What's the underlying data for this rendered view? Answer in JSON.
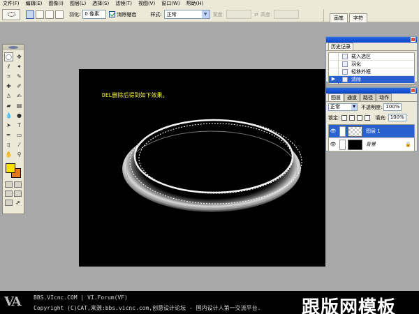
{
  "menu": {
    "items": [
      {
        "label": "文件(F)"
      },
      {
        "label": "编辑(E)"
      },
      {
        "label": "图像(I)"
      },
      {
        "label": "图层(L)"
      },
      {
        "label": "选择(S)"
      },
      {
        "label": "滤镜(T)"
      },
      {
        "label": "视图(V)"
      },
      {
        "label": "窗口(W)"
      },
      {
        "label": "帮助(H)"
      }
    ]
  },
  "options": {
    "feather_label": "羽化:",
    "feather_value": "0 像素",
    "antialias_label": "消除锯齿",
    "style_label": "样式:",
    "style_value": "正常",
    "width_label": "宽度:",
    "height_label": "高度:"
  },
  "palette_well": {
    "tabs": [
      "画笔",
      "字符"
    ]
  },
  "history": {
    "tab": "历史记录",
    "items": [
      {
        "label": "载入选区"
      },
      {
        "label": "羽化"
      },
      {
        "label": "轻移外框"
      },
      {
        "label": "清除"
      }
    ]
  },
  "layers": {
    "tabs": [
      "图层",
      "通道",
      "路径",
      "动作"
    ],
    "blend_mode": "正常",
    "opacity_label": "不透明度:",
    "opacity_value": "100%",
    "lock_label": "锁定:",
    "fill_label": "填充:",
    "fill_value": "100%",
    "items": [
      {
        "name": "图层 1"
      },
      {
        "name": "背景"
      }
    ]
  },
  "canvas": {
    "note": "DEL删除后得到如下效果。"
  },
  "footer": {
    "logo": "VA",
    "line1": "BBS.VIcnc.COM | VI.Forum(VF)",
    "line2": "Copyright (C)CAT,来源:bbs.vicnc.com,创意设计论坛 - 国内设计人第一交流平台.",
    "watermark": "跟版网模板"
  },
  "colors": {
    "foreground": "#ffe000",
    "background": "#e27a1a",
    "selection_highlight": "#2860d0",
    "note_text": "#ffff33"
  }
}
